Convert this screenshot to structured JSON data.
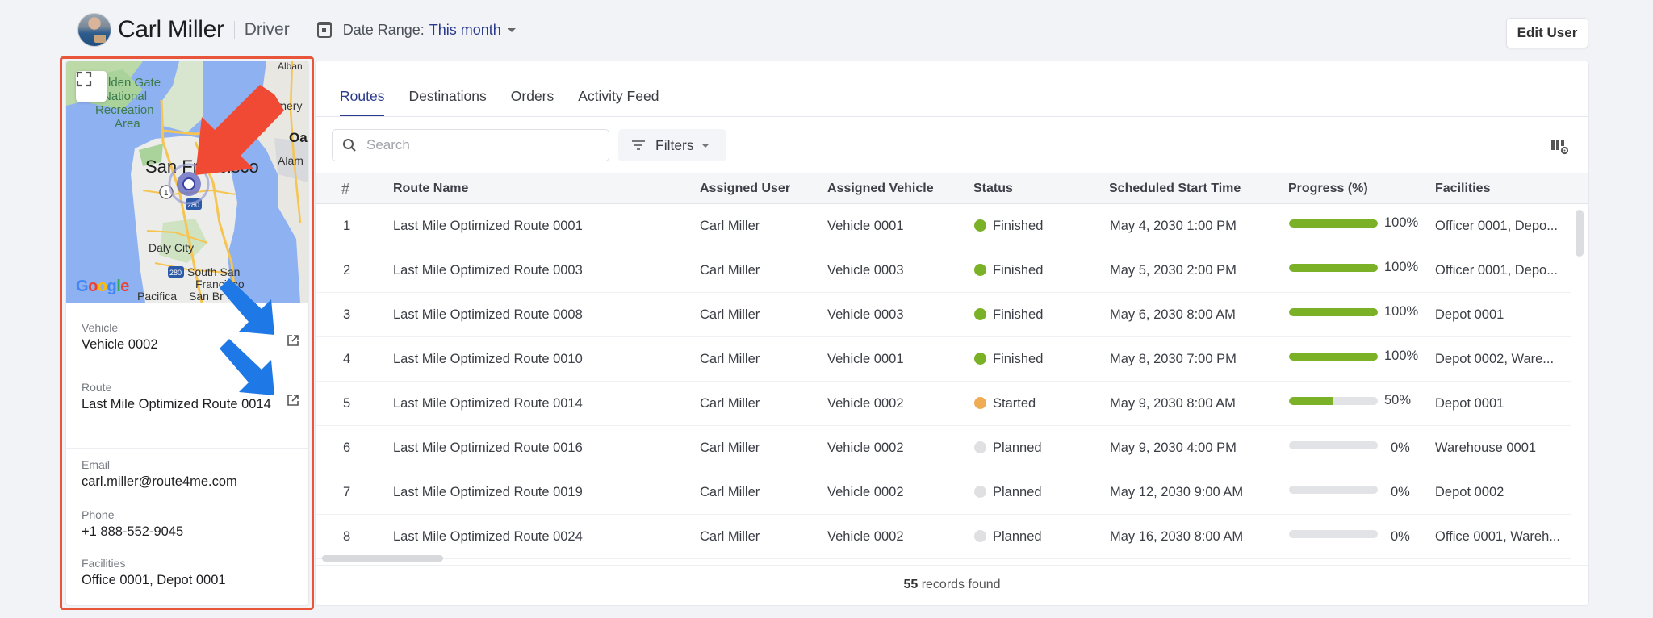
{
  "header": {
    "user_name": "Carl Miller",
    "user_role": "Driver",
    "date_range_label": "Date Range:",
    "date_range_value": "This month",
    "edit_button": "Edit User"
  },
  "profile_card": {
    "map": {
      "labels": [
        "Golden Gate National Recreation Area",
        "San Francisco",
        "Daly City",
        "South San Francisco",
        "Pacifica",
        "San Bruno",
        "Emeryville",
        "Oakland",
        "Alameda",
        "Albany"
      ],
      "attribution": "Google",
      "shields": [
        "1",
        "280",
        "280"
      ]
    },
    "vehicle": {
      "label": "Vehicle",
      "value": "Vehicle 0002"
    },
    "route": {
      "label": "Route",
      "value": "Last Mile Optimized Route 0014"
    },
    "email": {
      "label": "Email",
      "value": "carl.miller@route4me.com"
    },
    "phone": {
      "label": "Phone",
      "value": "+1 888-552-9045"
    },
    "facilities": {
      "label": "Facilities",
      "value": "Office 0001, Depot 0001"
    }
  },
  "tabs": [
    {
      "label": "Routes",
      "active": true
    },
    {
      "label": "Destinations",
      "active": false
    },
    {
      "label": "Orders",
      "active": false
    },
    {
      "label": "Activity Feed",
      "active": false
    }
  ],
  "toolbar": {
    "search_placeholder": "Search",
    "search_value": "",
    "filters_label": "Filters"
  },
  "table": {
    "columns": [
      "#",
      "Route Name",
      "Assigned User",
      "Assigned Vehicle",
      "Status",
      "Scheduled Start Time",
      "Progress (%)",
      "Facilities"
    ],
    "rows": [
      {
        "num": "1",
        "route": "Last Mile Optimized Route 0001",
        "user": "Carl Miller",
        "vehicle": "Vehicle 0001",
        "status": "Finished",
        "start": "May 4, 2030 1:00 PM",
        "progress": 100,
        "progress_label": "100%",
        "facilities": "Officer 0001, Depo..."
      },
      {
        "num": "2",
        "route": "Last Mile Optimized Route 0003",
        "user": "Carl Miller",
        "vehicle": "Vehicle 0003",
        "status": "Finished",
        "start": "May 5, 2030 2:00 PM",
        "progress": 100,
        "progress_label": "100%",
        "facilities": "Officer 0001, Depo..."
      },
      {
        "num": "3",
        "route": "Last Mile Optimized Route 0008",
        "user": "Carl Miller",
        "vehicle": "Vehicle 0003",
        "status": "Finished",
        "start": "May 6, 2030 8:00 AM",
        "progress": 100,
        "progress_label": "100%",
        "facilities": "Depot 0001"
      },
      {
        "num": "4",
        "route": "Last Mile Optimized Route 0010",
        "user": "Carl Miller",
        "vehicle": "Vehicle 0001",
        "status": "Finished",
        "start": "May 8, 2030 7:00 PM",
        "progress": 100,
        "progress_label": "100%",
        "facilities": "Depot 0002, Ware..."
      },
      {
        "num": "5",
        "route": "Last Mile Optimized Route 0014",
        "user": "Carl Miller",
        "vehicle": "Vehicle 0002",
        "status": "Started",
        "start": "May 9, 2030 8:00 AM",
        "progress": 50,
        "progress_label": "50%",
        "facilities": "Depot 0001"
      },
      {
        "num": "6",
        "route": "Last Mile Optimized Route 0016",
        "user": "Carl Miller",
        "vehicle": "Vehicle 0002",
        "status": "Planned",
        "start": "May 9, 2030 4:00 PM",
        "progress": 0,
        "progress_label": "0%",
        "facilities": "Warehouse 0001"
      },
      {
        "num": "7",
        "route": "Last Mile Optimized Route 0019",
        "user": "Carl Miller",
        "vehicle": "Vehicle 0002",
        "status": "Planned",
        "start": "May 12, 2030 9:00 AM",
        "progress": 0,
        "progress_label": "0%",
        "facilities": "Depot 0002"
      },
      {
        "num": "8",
        "route": "Last Mile Optimized Route 0024",
        "user": "Carl Miller",
        "vehicle": "Vehicle 0002",
        "status": "Planned",
        "start": "May 16, 2030 8:00 AM",
        "progress": 0,
        "progress_label": "0%",
        "facilities": "Office 0001, Wareh..."
      }
    ]
  },
  "status_colors": {
    "Finished": "#7ab126",
    "Started": "#f0ac52",
    "Planned": "#e0e0e2"
  },
  "progress_color": "#7ab126",
  "footer": {
    "records_count": "55",
    "records_suffix": " records found"
  },
  "colors": {
    "accent": "#2a3a8c",
    "highlight_outline": "#e8553a",
    "arrow_red": "#f04a34",
    "arrow_blue": "#1e78e6"
  }
}
